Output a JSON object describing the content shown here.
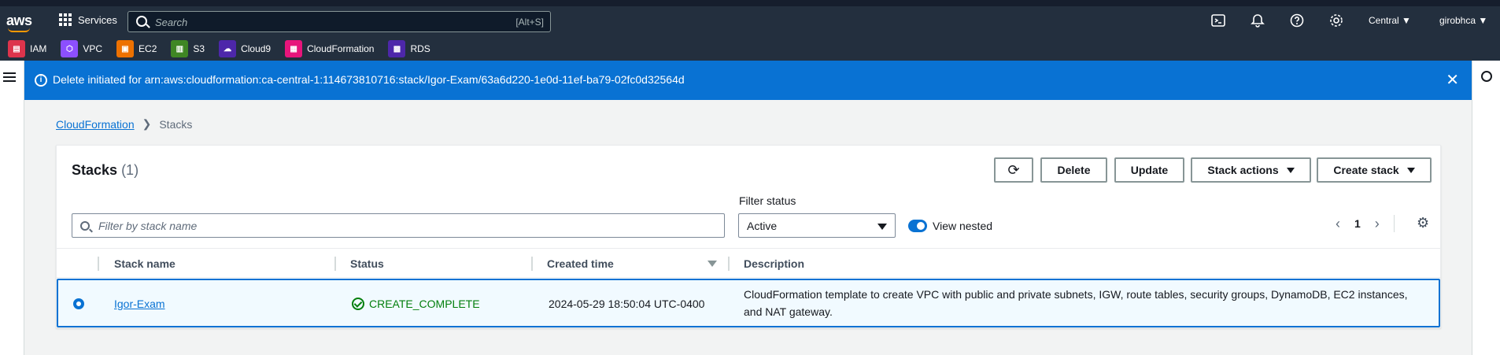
{
  "topnav": {
    "logo": "aws",
    "services_label": "Services",
    "search_placeholder": "Search",
    "search_shortcut": "[Alt+S]",
    "region": "Central",
    "account": "girobhca"
  },
  "favorites": [
    {
      "label": "IAM",
      "icon": "iam-icon",
      "color": "#dd344c",
      "glyph": "▤"
    },
    {
      "label": "VPC",
      "icon": "vpc-icon",
      "color": "#8c4fff",
      "glyph": "⬡"
    },
    {
      "label": "EC2",
      "icon": "ec2-icon",
      "color": "#ed7100",
      "glyph": "▣"
    },
    {
      "label": "S3",
      "icon": "s3-icon",
      "color": "#3f8624",
      "glyph": "▥"
    },
    {
      "label": "Cloud9",
      "icon": "cloud9-icon",
      "color": "#4d27aa",
      "glyph": "☁"
    },
    {
      "label": "CloudFormation",
      "icon": "cloudformation-icon",
      "color": "#e7157b",
      "glyph": "▦"
    },
    {
      "label": "RDS",
      "icon": "rds-icon",
      "color": "#4d27aa",
      "glyph": "▩"
    }
  ],
  "flash": {
    "message": "Delete initiated for arn:aws:cloudformation:ca-central-1:114673810716:stack/Igor-Exam/63a6d220-1e0d-11ef-ba79-02fc0d32564d"
  },
  "breadcrumb": {
    "parent": "CloudFormation",
    "current": "Stacks"
  },
  "panel": {
    "title": "Stacks",
    "count": "(1)",
    "buttons": {
      "delete": "Delete",
      "update": "Update",
      "stack_actions": "Stack actions",
      "create_stack": "Create stack"
    },
    "filter_placeholder": "Filter by stack name",
    "filter_status_label": "Filter status",
    "filter_status_value": "Active",
    "view_nested_label": "View nested",
    "view_nested_on": true,
    "page_number": "1"
  },
  "table": {
    "columns": [
      "Stack name",
      "Status",
      "Created time",
      "Description"
    ],
    "rows": [
      {
        "selected": true,
        "stack_name": "Igor-Exam",
        "status": "CREATE_COMPLETE",
        "created_time": "2024-05-29 18:50:04 UTC-0400",
        "description_line1": "CloudFormation template to create VPC with public and private subnets, IGW, route tables, security groups, DynamoDB, EC2 instances,",
        "description_line2": "and NAT gateway."
      }
    ]
  },
  "colors": {
    "nav_bg": "#232f3e",
    "flash_bg": "#0972d3",
    "link": "#0972d3",
    "success": "#037f0c"
  }
}
